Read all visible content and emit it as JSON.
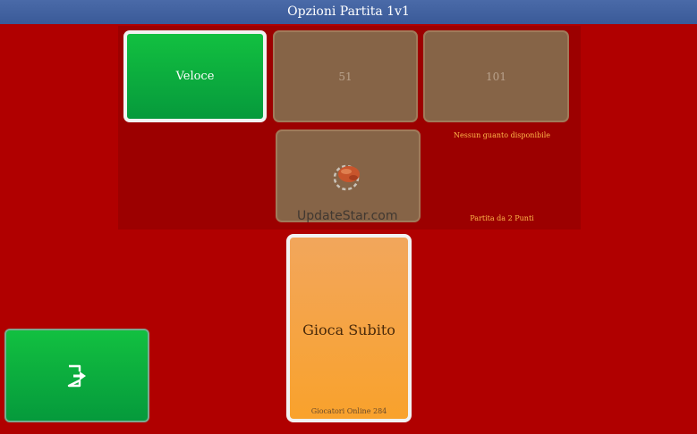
{
  "header": {
    "title": "Opzioni Partita 1v1"
  },
  "modes": [
    {
      "label": "Veloce",
      "selected": true
    },
    {
      "label": "51",
      "selected": false
    },
    {
      "label": "101",
      "selected": false
    }
  ],
  "glove": {
    "note": "Nessun guanto disponibile"
  },
  "points_note": "Partita da 2 Punti",
  "watermark": "UpdateStar.com",
  "play": {
    "label": "Gioca Subito",
    "online": "Giocatori Online 284"
  },
  "exit": {
    "icon": "exit-icon"
  },
  "colors": {
    "background": "#b00000",
    "selected": "#0aa83e",
    "play": "#f8a33a",
    "header": "#3d5c9c"
  }
}
